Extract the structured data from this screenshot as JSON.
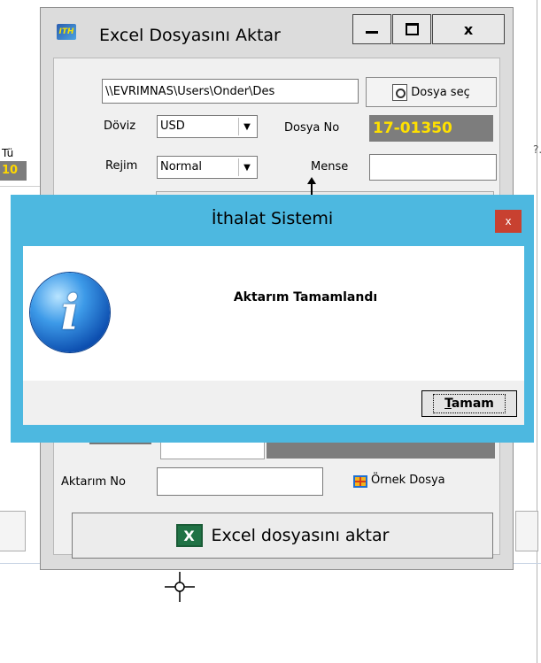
{
  "background": {
    "left_label": "Tü",
    "left_value": "10",
    "right_mark": "?."
  },
  "main_window": {
    "title": "Excel Dosyasını Aktar",
    "app_icon_text": "ITH",
    "buttons": {
      "minimize": "minimize",
      "maximize": "maximize",
      "close": "x"
    },
    "file_path": "\\\\EVRIMNAS\\Users\\Onder\\Des",
    "file_select_label": "Dosya seç",
    "doviz_label": "Döviz",
    "doviz_value": "USD",
    "dosya_no_label": "Dosya No",
    "dosya_no_value": "17-01350",
    "rejim_label": "Rejim",
    "rejim_value": "Normal",
    "mense_label": "Mense",
    "mense_value": "",
    "aktarim_no_label": "Aktarım No",
    "aktarim_no_value": "",
    "ornek_dosya_label": "Örnek Dosya",
    "excel_button_label": "Excel dosyasını aktar",
    "excel_icon_text": "X"
  },
  "dialog": {
    "title": "İthalat Sistemi",
    "close_label": "x",
    "message": "Aktarım Tamamlandı",
    "ok_first_letter": "T",
    "ok_rest": "amam"
  },
  "colors": {
    "dialog_frame": "#4db8e0",
    "dialog_close": "#c84130",
    "dosya_no_bg": "#7d7d7d",
    "dosya_no_text": "#ffe100",
    "excel_green": "#207245"
  }
}
